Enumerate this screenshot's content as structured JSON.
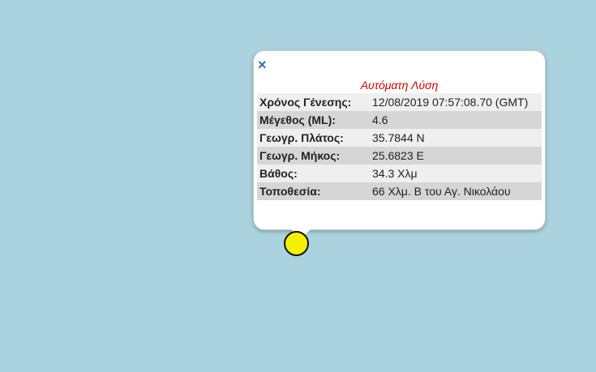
{
  "popup": {
    "close_symbol": "×",
    "title": "Αυτόματη Λύση",
    "rows": [
      {
        "label": "Χρόνος Γένεσης:",
        "value": "12/08/2019 07:57:08.70 (GMT)"
      },
      {
        "label": "Μέγεθος (ML):",
        "value": "4.6"
      },
      {
        "label": "Γεωγρ. Πλάτος:",
        "value": "35.7844 N"
      },
      {
        "label": "Γεωγρ. Μήκος:",
        "value": "25.6823 E"
      },
      {
        "label": "Βάθος:",
        "value": "34.3 Χλμ"
      },
      {
        "label": "Τοποθεσία:",
        "value": "66 Χλμ. Β του Αγ. Νικολάου"
      }
    ]
  },
  "colors": {
    "sea": "#aad3df",
    "marker_fill": "#f5f000",
    "title": "#cc0000",
    "close": "#2e6db4"
  },
  "icons": {
    "close": "close-icon",
    "marker": "earthquake-marker-icon"
  }
}
